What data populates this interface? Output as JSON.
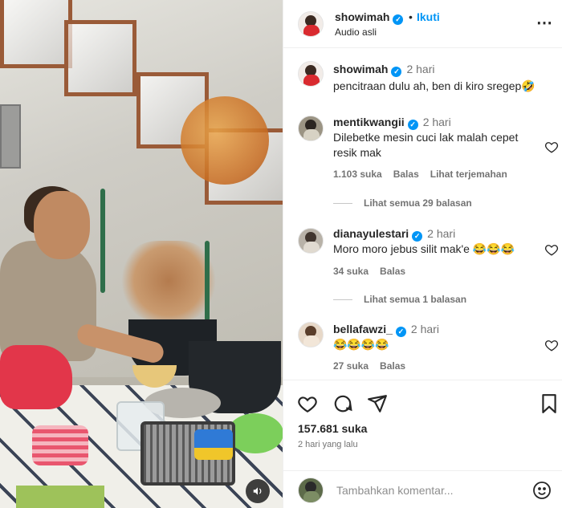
{
  "post": {
    "author": "showimah",
    "follow_label": "Ikuti",
    "audio_label": "Audio asli",
    "more_icon": "more-horizontal-icon"
  },
  "comments": [
    {
      "user": "showimah",
      "time": "2 hari",
      "text": "pencitraan dulu ah, ben di kiro sregep🤣",
      "verified": true
    },
    {
      "user": "mentikwangii",
      "time": "2 hari",
      "text": "Dilebetke mesin cuci lak malah cepet resik mak",
      "likes": "1.103 suka",
      "reply_label": "Balas",
      "translate_label": "Lihat terjemahan",
      "view_replies": "Lihat semua 29 balasan",
      "verified": true
    },
    {
      "user": "dianayulestari",
      "time": "2 hari",
      "text": "Moro moro jebus silit mak'e 😂😂😂",
      "likes": "34 suka",
      "reply_label": "Balas",
      "view_replies": "Lihat semua 1 balasan",
      "verified": true
    },
    {
      "user": "bellafawzi_",
      "time": "2 hari",
      "text": "😂😂😂😂",
      "likes": "27 suka",
      "reply_label": "Balas",
      "verified": true
    }
  ],
  "actions": {
    "like_icon": "heart-icon",
    "comment_icon": "comment-icon",
    "share_icon": "share-icon",
    "save_icon": "bookmark-icon"
  },
  "stats": {
    "likes": "157.681 suka",
    "posted_ago": "2 hari yang lalu"
  },
  "composer": {
    "placeholder": "Tambahkan komentar..."
  },
  "colors": {
    "verified": "#0095f6",
    "link": "#0095f6",
    "muted": "#737373"
  }
}
